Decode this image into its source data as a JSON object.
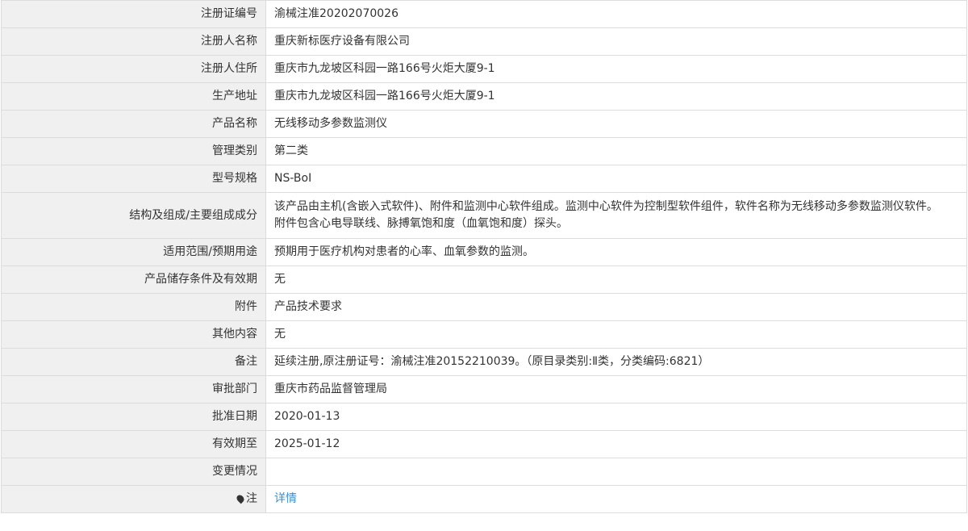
{
  "rows": [
    {
      "label": "注册证编号",
      "value": "渝械注准20202070026"
    },
    {
      "label": "注册人名称",
      "value": "重庆新标医疗设备有限公司"
    },
    {
      "label": "注册人住所",
      "value": "重庆市九龙坡区科园一路166号火炬大厦9-1"
    },
    {
      "label": "生产地址",
      "value": "重庆市九龙坡区科园一路166号火炬大厦9-1"
    },
    {
      "label": "产品名称",
      "value": "无线移动多参数监测仪"
    },
    {
      "label": "管理类别",
      "value": "第二类"
    },
    {
      "label": "型号规格",
      "value": "NS-BoⅠ"
    },
    {
      "label": "结构及组成/主要组成成分",
      "value_line1": "该产品由主机(含嵌入式软件)、附件和监测中心软件组成。监测中心软件为控制型软件组件，软件名称为无线移动多参数监测仪软件。",
      "value_line2": "附件包含心电导联线、脉搏氧饱和度（血氧饱和度）探头。"
    },
    {
      "label": "适用范围/预期用途",
      "value": "预期用于医疗机构对患者的心率、血氧参数的监测。"
    },
    {
      "label": "产品储存条件及有效期",
      "value": "无"
    },
    {
      "label": "附件",
      "value": "产品技术要求"
    },
    {
      "label": "其他内容",
      "value": "无"
    },
    {
      "label": "备注",
      "value": "延续注册,原注册证号：渝械注准20152210039。（原目录类别:Ⅱ类，分类编码:6821）"
    },
    {
      "label": "审批部门",
      "value": "重庆市药品监督管理局"
    },
    {
      "label": "批准日期",
      "value": "2020-01-13"
    },
    {
      "label": "有效期至",
      "value": "2025-01-12"
    },
    {
      "label": "变更情况",
      "value": ""
    },
    {
      "label": "注",
      "icon": "map-pin-icon",
      "value": "详情"
    }
  ]
}
